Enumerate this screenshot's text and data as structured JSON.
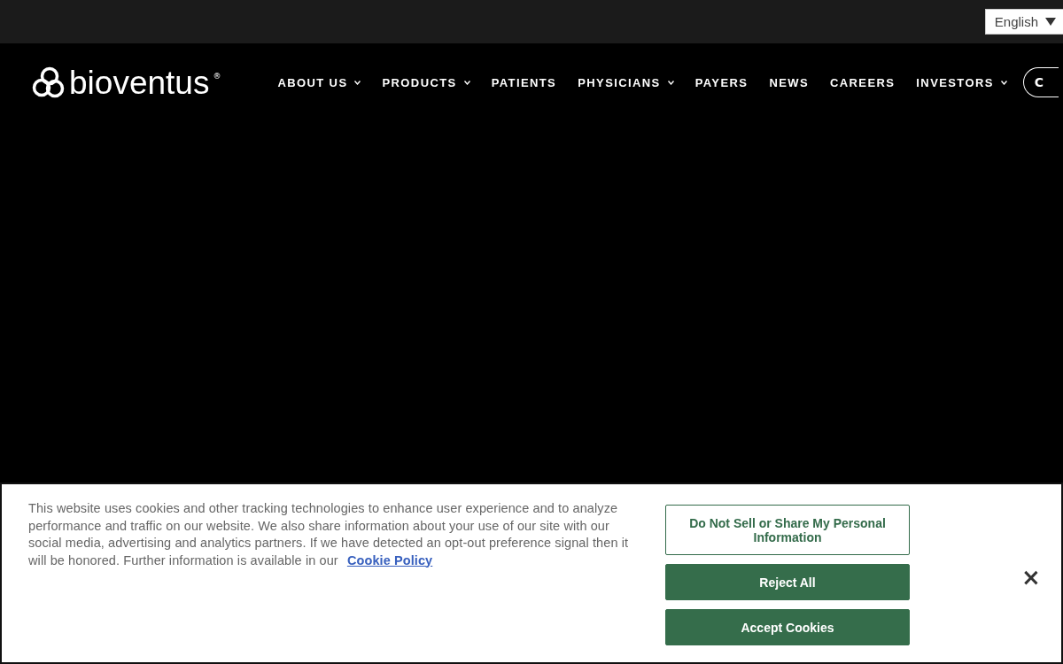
{
  "language_select": {
    "value": "English"
  },
  "logo": {
    "name": "bioventus",
    "mark": "®"
  },
  "nav": [
    {
      "label": "ABOUT US",
      "has_menu": true
    },
    {
      "label": "PRODUCTS",
      "has_menu": true
    },
    {
      "label": "PATIENTS",
      "has_menu": false
    },
    {
      "label": "PHYSICIANS",
      "has_menu": true
    },
    {
      "label": "PAYERS",
      "has_menu": false
    },
    {
      "label": "NEWS",
      "has_menu": false
    },
    {
      "label": "CAREERS",
      "has_menu": false
    },
    {
      "label": "INVESTORS",
      "has_menu": true
    }
  ],
  "header_button": {
    "label": "C"
  },
  "cookie_banner": {
    "text": "This website uses cookies and other tracking technologies to enhance user experience and to analyze performance and traffic on our website. We also share information about your use of our site with our social media, advertising and analytics partners. If we have detected an opt-out preference signal then it will be honored. Further information is available in our",
    "link": "Cookie Policy",
    "buttons": [
      {
        "label": "Do Not Sell or Share My Personal Information",
        "kind": "outline"
      },
      {
        "label": "Reject All",
        "kind": "filled"
      },
      {
        "label": "Accept Cookies",
        "kind": "filled"
      }
    ],
    "close": "×"
  }
}
